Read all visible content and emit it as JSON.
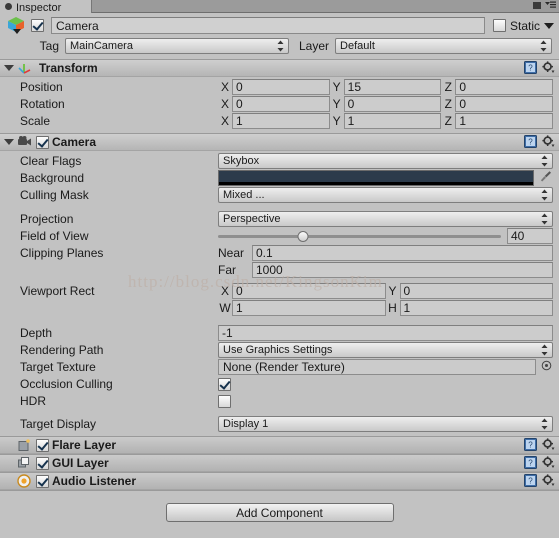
{
  "window": {
    "tab_label": "Inspector",
    "lock_icon": "lock-icon",
    "menu_icon": "hamburger-menu-icon"
  },
  "gameobject": {
    "icon": "gameobject-cube-icon",
    "enabled": true,
    "name": "Camera",
    "name_placeholder": "Name",
    "static_label": "Static",
    "static_checked": false,
    "tag_label": "Tag",
    "tag_value": "MainCamera",
    "layer_label": "Layer",
    "layer_value": "Default"
  },
  "components": [
    {
      "id": "transform",
      "title": "Transform",
      "icon": "transform-axis-icon",
      "expanded": true,
      "has_enable_checkbox": false,
      "rows": [
        {
          "label": "Position",
          "type": "vector3",
          "x": "0",
          "y": "15",
          "z": "0"
        },
        {
          "label": "Rotation",
          "type": "vector3",
          "x": "0",
          "y": "0",
          "z": "0"
        },
        {
          "label": "Scale",
          "type": "vector3",
          "x": "1",
          "y": "1",
          "z": "1"
        }
      ]
    },
    {
      "id": "camera",
      "title": "Camera",
      "icon": "camera-icon",
      "expanded": true,
      "has_enable_checkbox": true,
      "enabled": true
    },
    {
      "id": "flare-layer",
      "title": "Flare Layer",
      "icon": "flare-layer-icon",
      "expanded": false,
      "has_enable_checkbox": true,
      "enabled": true
    },
    {
      "id": "gui-layer",
      "title": "GUI Layer",
      "icon": "gui-layer-icon",
      "expanded": false,
      "has_enable_checkbox": true,
      "enabled": true
    },
    {
      "id": "audio-listener",
      "title": "Audio Listener",
      "icon": "audio-listener-icon",
      "expanded": false,
      "has_enable_checkbox": true,
      "enabled": true
    }
  ],
  "camera_props": {
    "clear_flags_label": "Clear Flags",
    "clear_flags_value": "Skybox",
    "background_label": "Background",
    "background_color": "#2C3B4B",
    "background_alpha_color": "#000000",
    "culling_mask_label": "Culling Mask",
    "culling_mask_value": "Mixed ...",
    "projection_label": "Projection",
    "projection_value": "Perspective",
    "fov_label": "Field of View",
    "fov_value": "40",
    "fov_percent": 30,
    "clipping_label": "Clipping Planes",
    "near_label": "Near",
    "near_value": "0.1",
    "far_label": "Far",
    "far_value": "1000",
    "viewport_label": "Viewport Rect",
    "viewport_x_axis": "X",
    "viewport_x": "0",
    "viewport_y_axis": "Y",
    "viewport_y": "0",
    "viewport_w_axis": "W",
    "viewport_w": "1",
    "viewport_h_axis": "H",
    "viewport_h": "1",
    "depth_label": "Depth",
    "depth_value": "-1",
    "rendering_path_label": "Rendering Path",
    "rendering_path_value": "Use Graphics Settings",
    "target_texture_label": "Target Texture",
    "target_texture_value": "None (Render Texture)",
    "occlusion_label": "Occlusion Culling",
    "occlusion_checked": true,
    "hdr_label": "HDR",
    "hdr_checked": false,
    "target_display_label": "Target Display",
    "target_display_value": "Display 1"
  },
  "axes": {
    "x": "X",
    "y": "Y",
    "z": "Z"
  },
  "footer": {
    "add_component_label": "Add Component"
  },
  "watermark": {
    "text": "http://blog.csdn.net/KingsonKim"
  },
  "icons": {
    "help": "help-book-icon",
    "gear": "settings-gear-icon",
    "eyedropper": "eyedropper-icon",
    "select_object": "object-picker-icon"
  }
}
